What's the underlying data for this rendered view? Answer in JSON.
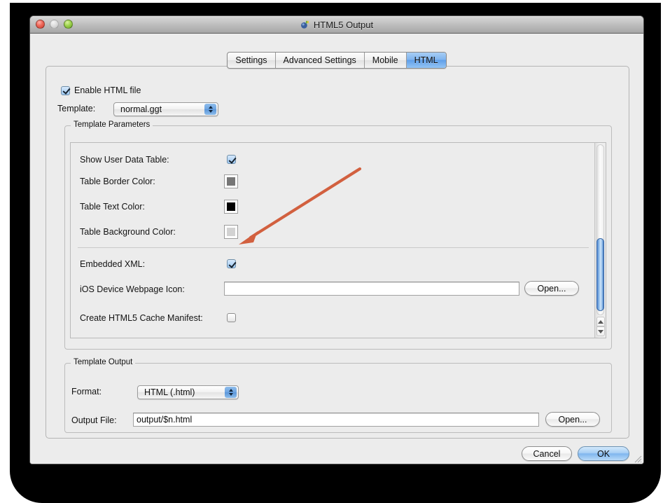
{
  "window": {
    "title": "HTML5 Output",
    "title_icon": "app-icon",
    "controls": {
      "close": "close-button",
      "minimize": "minimize-button",
      "zoom": "zoom-button"
    }
  },
  "tabs": [
    {
      "label": "Settings",
      "selected": false
    },
    {
      "label": "Advanced Settings",
      "selected": false
    },
    {
      "label": "Mobile",
      "selected": false
    },
    {
      "label": "HTML",
      "selected": true
    }
  ],
  "enable_html": {
    "label": "Enable HTML file",
    "checked": true
  },
  "template": {
    "label": "Template:",
    "value": "normal.ggt"
  },
  "template_parameters": {
    "group_label": "Template Parameters",
    "rows": [
      {
        "label": "Show User Data Table:",
        "control": "checkbox",
        "checked": true
      },
      {
        "label": "Table Border Color:",
        "control": "color-swatch",
        "color": "#767676"
      },
      {
        "label": "Table Text Color:",
        "control": "color-swatch",
        "color": "#000000"
      },
      {
        "label": "Table Background Color:",
        "control": "color-swatch",
        "color": "#d2d2d2"
      },
      {
        "label": "Embedded XML:",
        "control": "checkbox",
        "checked": true
      },
      {
        "label": "iOS Device Webpage Icon:",
        "control": "textfield-with-button",
        "value": "",
        "button": "Open..."
      },
      {
        "label": "Create HTML5 Cache Manifest:",
        "control": "checkbox",
        "checked": false
      }
    ]
  },
  "template_output": {
    "group_label": "Template Output",
    "format": {
      "label": "Format:",
      "value": "HTML (.html)"
    },
    "output_file": {
      "label": "Output File:",
      "value": "output/$n.html",
      "button": "Open..."
    }
  },
  "footer": {
    "cancel": "Cancel",
    "ok": "OK"
  },
  "annotation": {
    "type": "arrow",
    "color": "#d2603f",
    "points_to": "Embedded XML checkbox"
  }
}
